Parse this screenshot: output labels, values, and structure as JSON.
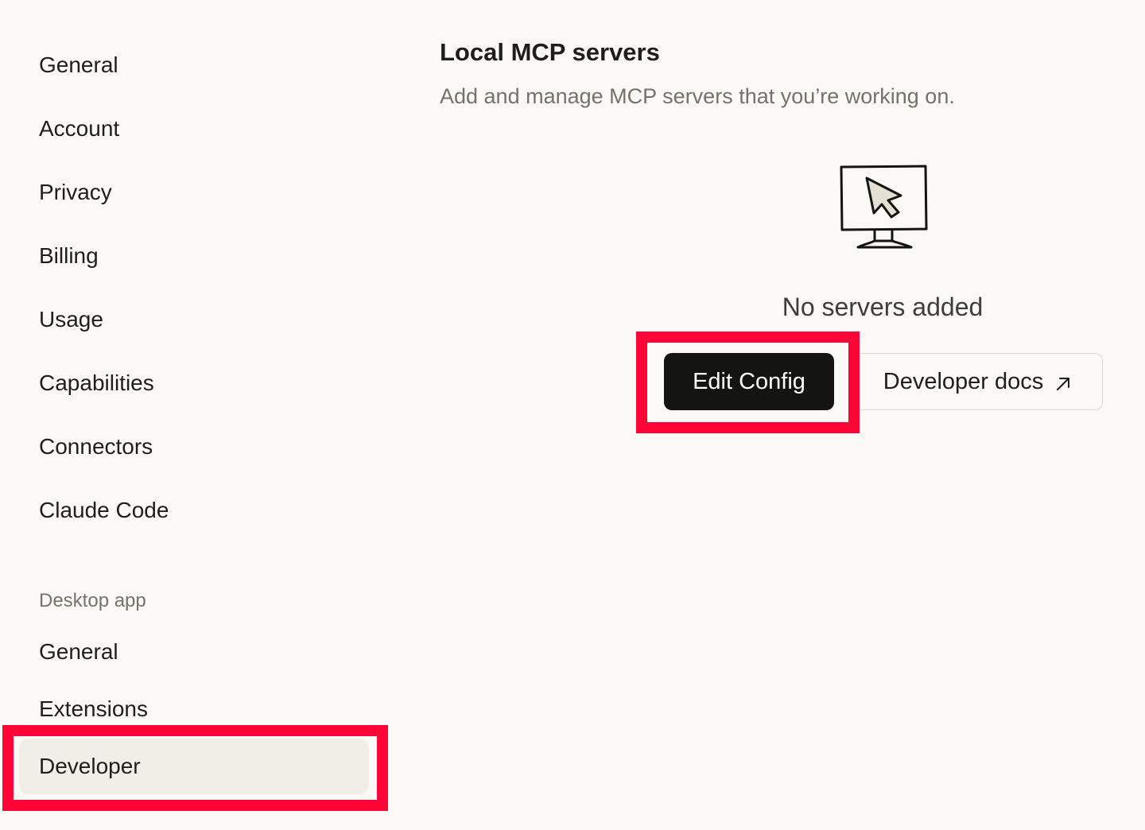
{
  "sidebar": {
    "items": [
      {
        "label": "General"
      },
      {
        "label": "Account"
      },
      {
        "label": "Privacy"
      },
      {
        "label": "Billing"
      },
      {
        "label": "Usage"
      },
      {
        "label": "Capabilities"
      },
      {
        "label": "Connectors"
      },
      {
        "label": "Claude Code"
      }
    ],
    "desktop_heading": "Desktop app",
    "desktop_items": [
      {
        "label": "General"
      },
      {
        "label": "Extensions"
      },
      {
        "label": "Developer",
        "active": true
      }
    ]
  },
  "main": {
    "title": "Local MCP servers",
    "subtitle": "Add and manage MCP servers that you’re working on.",
    "empty_icon": "computer-cursor-icon",
    "empty_text": "No servers added",
    "edit_config_label": "Edit Config",
    "developer_docs_label": "Developer docs",
    "external_link_icon": "arrow-up-right-icon"
  },
  "colors": {
    "background": "#faf9f5",
    "active_item_bg": "#f0eee6",
    "primary_button": "#141413",
    "highlight": "#ff0537"
  }
}
